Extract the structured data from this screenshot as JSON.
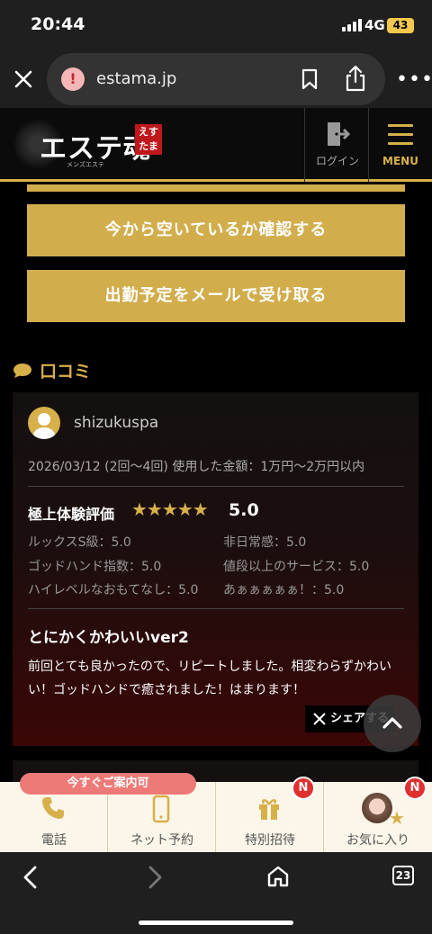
{
  "status_bar": {
    "time": "20:44",
    "network": "4G",
    "battery": "43"
  },
  "browser": {
    "url": "estama.jp",
    "tabs_count": "23"
  },
  "header": {
    "logo_text": "エステ魂",
    "logo_tag": "えすたま",
    "logo_sub": "メンズエステ",
    "login_label": "ログイン",
    "menu_label": "MENU"
  },
  "actions": {
    "check_availability": "今から空いているか確認する",
    "receive_schedule": "出勤予定をメールで受け取る"
  },
  "reviews_section": {
    "title": "口コミ",
    "review": {
      "reviewer": "shizukuspa",
      "meta": "2026/03/12 (2回〜4回) 使用した金額：1万円〜2万円以内",
      "rating_label": "極上体験評価",
      "stars": "★★★★★",
      "rating_value": "5.0",
      "scores": [
        "ルックスS級：5.0",
        "非日常感：5.0",
        "ゴッドハンド指数：5.0",
        "値段以上のサービス：5.0",
        "ハイレベルなおもてなし：5.0",
        "あぁぁぁぁぁ！：5.0"
      ],
      "title": "とにかくかわいいver2",
      "body": "前回とても良かったので、リピートしました。相変わらずかわいい！ゴッドハンドで癒されました！はまります！",
      "share_label": "シェアする"
    }
  },
  "bottom_bar": {
    "availability_badge": "今すぐご案内可",
    "items": [
      {
        "label": "電話",
        "badge": ""
      },
      {
        "label": "ネット予約",
        "badge": ""
      },
      {
        "label": "特別招待",
        "badge": "N"
      },
      {
        "label": "お気に入り",
        "badge": "N"
      }
    ]
  },
  "colors": {
    "gold": "#d2ad4c",
    "card_bottom": "#3b0606",
    "badge_red": "#e03030"
  }
}
